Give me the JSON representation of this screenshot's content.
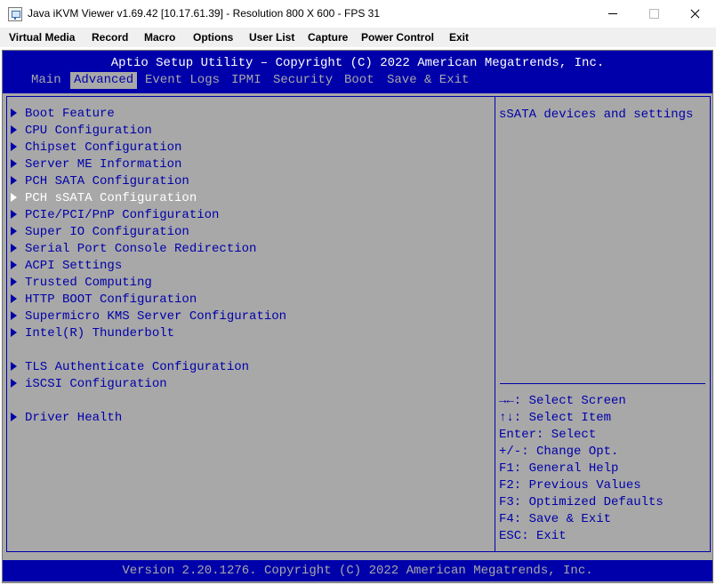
{
  "window": {
    "title": "Java iKVM Viewer v1.69.42 [10.17.61.39]  - Resolution 800 X 600 - FPS 31",
    "icon": "java-app-icon"
  },
  "menubar": {
    "items": [
      "Virtual Media",
      "Record",
      "Macro",
      "Options",
      "User List",
      "Capture",
      "Power Control",
      "Exit"
    ]
  },
  "bios": {
    "title": "Aptio Setup Utility – Copyright (C) 2022 American Megatrends, Inc.",
    "tabs": [
      "Main",
      "Advanced",
      "Event Logs",
      "IPMI",
      "Security",
      "Boot",
      "Save & Exit"
    ],
    "active_tab": "Advanced",
    "menu_items": [
      "Boot Feature",
      "CPU Configuration",
      "Chipset Configuration",
      "Server ME Information",
      "PCH SATA Configuration",
      "PCH sSATA Configuration",
      "PCIe/PCI/PnP Configuration",
      "Super IO Configuration",
      "Serial Port Console Redirection",
      "ACPI Settings",
      "Trusted Computing",
      "HTTP BOOT Configuration",
      "Supermicro KMS Server Configuration",
      "Intel(R) Thunderbolt",
      "TLS Authenticate Configuration",
      "iSCSI Configuration",
      "Driver Health"
    ],
    "selected_item": "PCH sSATA Configuration",
    "help_text": "sSATA devices and settings",
    "key_help": [
      "→←: Select Screen",
      "↑↓: Select Item",
      "Enter: Select",
      "+/-: Change Opt.",
      "F1: General Help",
      "F2: Previous Values",
      "F3: Optimized Defaults",
      "F4: Save & Exit",
      "ESC: Exit"
    ],
    "footer": "Version 2.20.1276. Copyright (C) 2022 American Megatrends, Inc.",
    "colors": {
      "background": "#a8a8a8",
      "accent": "#0000aa",
      "highlight": "#ffffff"
    }
  }
}
